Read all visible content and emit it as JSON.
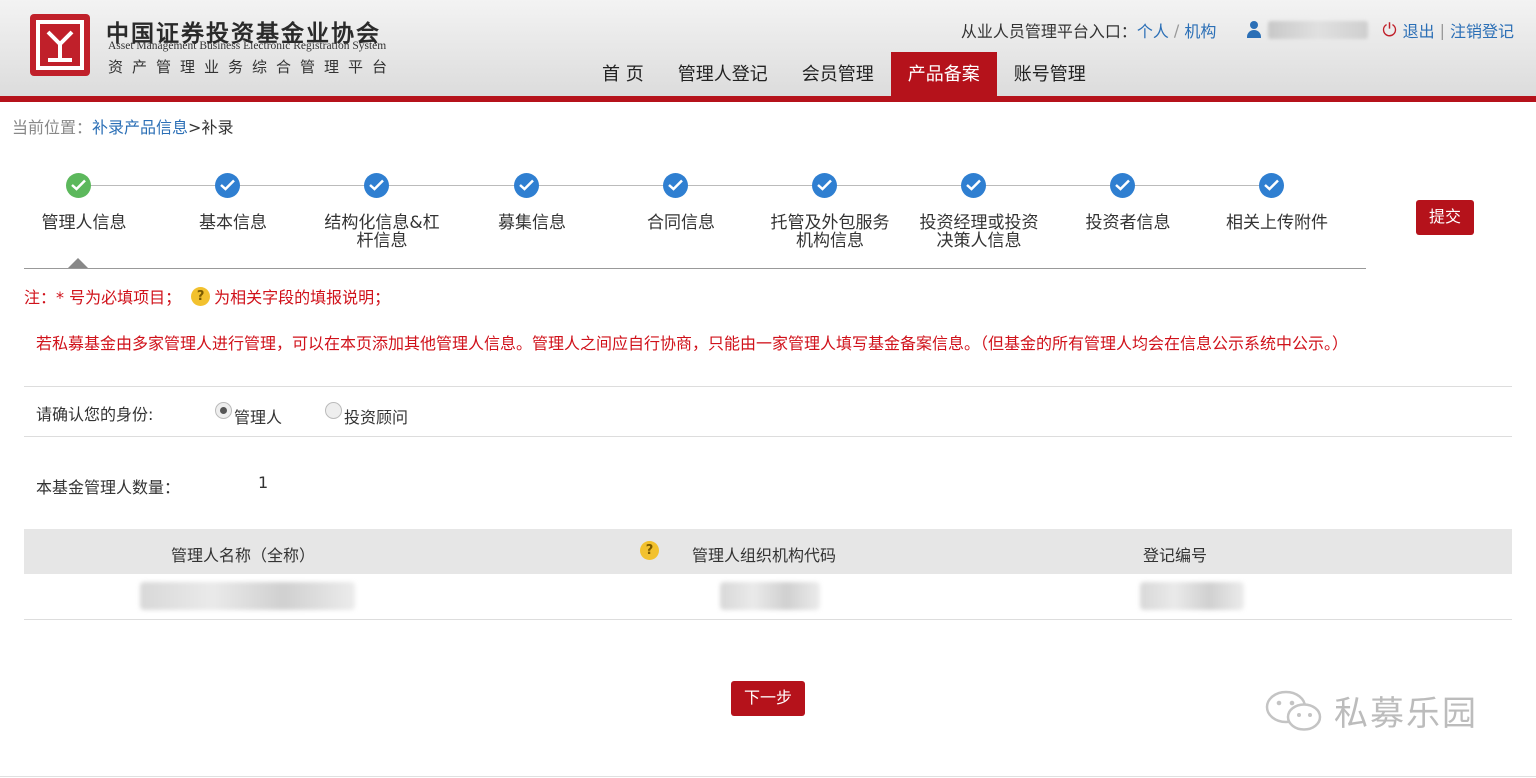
{
  "header": {
    "org_name_cn": "中国证券投资基金业协会",
    "org_name_en": "Asset Management Business Electronic Registration System",
    "org_subtitle": "资产管理业务综合管理平台",
    "entry_label": "从业人员管理平台入口：",
    "entry_personal": "个人",
    "entry_slash": "/",
    "entry_org": "机构",
    "logout": "退出",
    "divider": "|",
    "cancel_register": "注销登记"
  },
  "nav": {
    "items": [
      "首 页",
      "管理人登记",
      "会员管理",
      "产品备案",
      "账号管理"
    ],
    "active_index": 3
  },
  "breadcrumb": {
    "prefix": "当前位置：",
    "link": "补录产品信息",
    "sep": ">",
    "current": "补录"
  },
  "steps": {
    "items": [
      "管理人信息",
      "基本信息",
      "结构化信息&杠杆信息",
      "募集信息",
      "合同信息",
      "托管及外包服务机构信息",
      "投资经理或投资决策人信息",
      "投资者信息",
      "相关上传附件"
    ]
  },
  "submit_label": "提交",
  "notes": {
    "prefix": "注：* 号为必填项目；",
    "help_icon": "?",
    "help_text": "为相关字段的填报说明；",
    "multi_manager": "若私募基金由多家管理人进行管理，可以在本页添加其他管理人信息。管理人之间应自行协商，只能由一家管理人填写基金备案信息。（但基金的所有管理人均会在信息公示系统中公示。）"
  },
  "identity": {
    "label": "请确认您的身份:",
    "options": [
      "管理人",
      "投资顾问"
    ],
    "selected": 0
  },
  "manager_count": {
    "label": "本基金管理人数量：",
    "value": "1"
  },
  "table": {
    "headers": [
      "管理人名称（全称）",
      "管理人组织机构代码",
      "登记编号"
    ],
    "help_icon": "?"
  },
  "next_label": "下一步",
  "watermark": "私募乐园",
  "colors": {
    "brand_red": "#b5121b",
    "link_blue": "#2b6fb6",
    "step_blue": "#2f7fd1",
    "step_green": "#5cb85c",
    "note_red": "#d0111a"
  }
}
